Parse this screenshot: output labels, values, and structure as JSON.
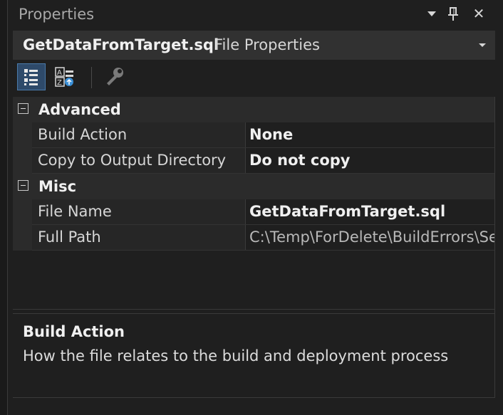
{
  "window": {
    "title": "Properties"
  },
  "title_buttons": [
    {
      "name": "window-position-menu",
      "icon": "caret-down-icon"
    },
    {
      "name": "auto-hide",
      "icon": "pin-icon"
    },
    {
      "name": "close",
      "icon": "close-icon",
      "glyph": "✕"
    }
  ],
  "object_selector": {
    "name": "GetDataFromTarget.sql",
    "type": "File Properties"
  },
  "toolbar": {
    "buttons": [
      {
        "name": "categorized",
        "icon": "categorized-view-icon",
        "active": true
      },
      {
        "name": "alphabetical",
        "icon": "alphabetical-sort-icon",
        "active": false
      },
      {
        "name": "property-pages",
        "icon": "wrench-icon",
        "active": false
      }
    ]
  },
  "grid": {
    "categories": [
      {
        "label": "Advanced",
        "properties": [
          {
            "name": "Build Action",
            "value": "None"
          },
          {
            "name": "Copy to Output Directory",
            "value": "Do not copy"
          }
        ]
      },
      {
        "label": "Misc",
        "properties": [
          {
            "name": "File Name",
            "value": "GetDataFromTarget.sql"
          },
          {
            "name": "Full Path",
            "value": "C:\\Temp\\ForDelete\\BuildErrors\\Se"
          }
        ]
      }
    ]
  },
  "description": {
    "title": "Build Action",
    "text": "How the file relates to the build and deployment process"
  },
  "colors": {
    "background": "#1f1f1f",
    "header_bar": "#313131",
    "category_row": "#2b2b2b",
    "active_button": "#2e4a6a",
    "accent_blue": "#3a8fd6"
  }
}
